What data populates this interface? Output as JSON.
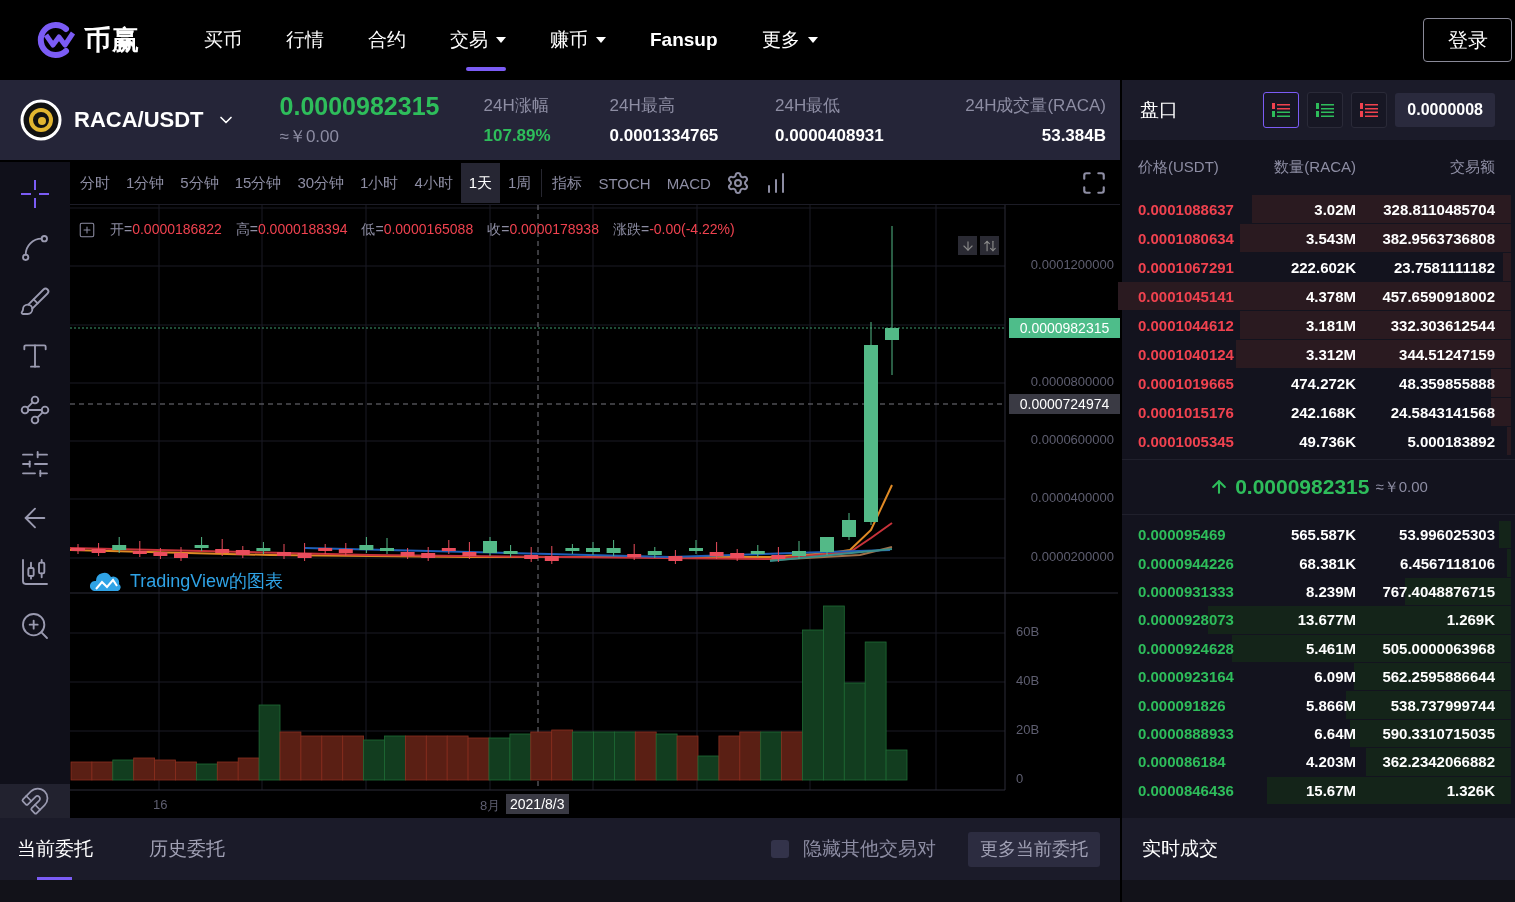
{
  "nav": {
    "brand": "币赢",
    "login": "登录",
    "items": [
      {
        "label": "买币",
        "selected": false,
        "has_menu": false,
        "kind": "link"
      },
      {
        "label": "行情",
        "selected": false,
        "has_menu": false,
        "kind": "link"
      },
      {
        "label": "合约",
        "selected": false,
        "has_menu": false,
        "kind": "link"
      },
      {
        "label": "交易",
        "selected": true,
        "has_menu": true,
        "kind": "link"
      },
      {
        "label": "赚币",
        "selected": false,
        "has_menu": true,
        "kind": "link"
      },
      {
        "label": "Fansup",
        "selected": false,
        "has_menu": false,
        "kind": "promo"
      },
      {
        "label": "更多",
        "selected": false,
        "has_menu": true,
        "kind": "link"
      }
    ]
  },
  "ticker": {
    "pair": "RACA/USDT",
    "price": "0.0000982315",
    "price_cny": "≈￥0.00",
    "stats": [
      {
        "label": "24H涨幅",
        "value": "107.89%",
        "kind": "change"
      },
      {
        "label": "24H最高",
        "value": "0.0001334765",
        "kind": "plain"
      },
      {
        "label": "24H最低",
        "value": "0.0000408931",
        "kind": "plain"
      },
      {
        "label": "24H成交量(RACA)",
        "value": "53.384B",
        "kind": "plain"
      }
    ]
  },
  "chart": {
    "intervals": [
      {
        "label": "分时",
        "selected": false
      },
      {
        "label": "1分钟",
        "selected": false
      },
      {
        "label": "5分钟",
        "selected": false
      },
      {
        "label": "15分钟",
        "selected": false
      },
      {
        "label": "30分钟",
        "selected": false
      },
      {
        "label": "1小时",
        "selected": false
      },
      {
        "label": "4小时",
        "selected": false
      },
      {
        "label": "1天",
        "selected": true
      },
      {
        "label": "1周",
        "selected": false
      }
    ],
    "indicators": [
      "指标",
      "STOCH",
      "MACD"
    ],
    "legend": [
      {
        "label": "开=",
        "value": "0.0000186822"
      },
      {
        "label": "高=",
        "value": "0.0000188394"
      },
      {
        "label": "低=",
        "value": "0.0000165088"
      },
      {
        "label": "收=",
        "value": "0.0000178938"
      },
      {
        "label": "涨跌=",
        "value": "-0.00(-4.22%)"
      }
    ],
    "source_label": "TradingView的图表",
    "price_ticks": [
      "0.0001200000",
      "0.0000800000",
      "0.0000600000",
      "0.0000400000",
      "0.0000200000"
    ],
    "last_price_tag": "0.0000982315",
    "crosshair_price": "0.0000724974",
    "volume_ticks": [
      "60B",
      "40B",
      "20B",
      "0"
    ],
    "time_ticks": [
      "16",
      "8月"
    ],
    "crosshair_time": "2021/8/3"
  },
  "orderbook": {
    "title": "盘口",
    "precision": "0.0000008",
    "modes": [
      {
        "kind": "both",
        "selected": true
      },
      {
        "kind": "bids",
        "selected": false
      },
      {
        "kind": "asks",
        "selected": false
      }
    ],
    "columns": [
      "价格(USDT)",
      "数量(RACA)",
      "交易额"
    ],
    "asks": [
      {
        "price": "0.0001088637",
        "amount": "3.02M",
        "total": "328.8110485704",
        "level": 0.66
      },
      {
        "price": "0.0001080634",
        "amount": "3.543M",
        "total": "382.9563736808",
        "level": 0.69
      },
      {
        "price": "0.0001067291",
        "amount": "222.602K",
        "total": "23.7581111182",
        "level": 0.02
      },
      {
        "price": "0.0001045141",
        "amount": "4.378M",
        "total": "457.6590918002",
        "level": 1
      },
      {
        "price": "0.0001044612",
        "amount": "3.181M",
        "total": "332.303612544",
        "level": 0.69
      },
      {
        "price": "0.0001040124",
        "amount": "3.312M",
        "total": "344.51247159",
        "level": 0.7
      },
      {
        "price": "0.0001019665",
        "amount": "474.272K",
        "total": "48.359855888",
        "level": 0.05
      },
      {
        "price": "0.0001015176",
        "amount": "242.168K",
        "total": "24.5843141568",
        "level": 0.05
      },
      {
        "price": "0.0001005345",
        "amount": "49.736K",
        "total": "5.000183892",
        "level": 0.01
      }
    ],
    "last": {
      "price": "0.0000982315",
      "cny": "≈￥0.00"
    },
    "bids": [
      {
        "price": "0.000095469",
        "amount": "565.587K",
        "total": "53.996025303",
        "level": 0.03
      },
      {
        "price": "0.0000944226",
        "amount": "68.381K",
        "total": "6.4567118106",
        "level": 0.01
      },
      {
        "price": "0.0000931333",
        "amount": "8.239M",
        "total": "767.4048876715",
        "level": 0.27
      },
      {
        "price": "0.0000928073",
        "amount": "13.677M",
        "total": "1.269K",
        "level": 0.77
      },
      {
        "price": "0.0000924628",
        "amount": "5.461M",
        "total": "505.0000063968",
        "level": 0.71
      },
      {
        "price": "0.0000923164",
        "amount": "6.09M",
        "total": "562.2595886644",
        "level": 0.4
      },
      {
        "price": "0.000091826",
        "amount": "5.866M",
        "total": "538.737999744",
        "level": 0.42
      },
      {
        "price": "0.0000888933",
        "amount": "6.64M",
        "total": "590.3310715035",
        "level": 0.41
      },
      {
        "price": "0.000086184",
        "amount": "4.203M",
        "total": "362.2342066882",
        "level": 0.37
      },
      {
        "price": "0.0000846436",
        "amount": "15.67M",
        "total": "1.326K",
        "level": 0.62
      }
    ]
  },
  "orders": {
    "tabs": [
      {
        "label": "当前委托",
        "selected": true
      },
      {
        "label": "历史委托",
        "selected": false
      }
    ],
    "hide_others": {
      "label": "隐藏其他交易对",
      "checked": false
    },
    "more": "更多当前委托"
  },
  "trades": {
    "title": "实时成交"
  }
}
